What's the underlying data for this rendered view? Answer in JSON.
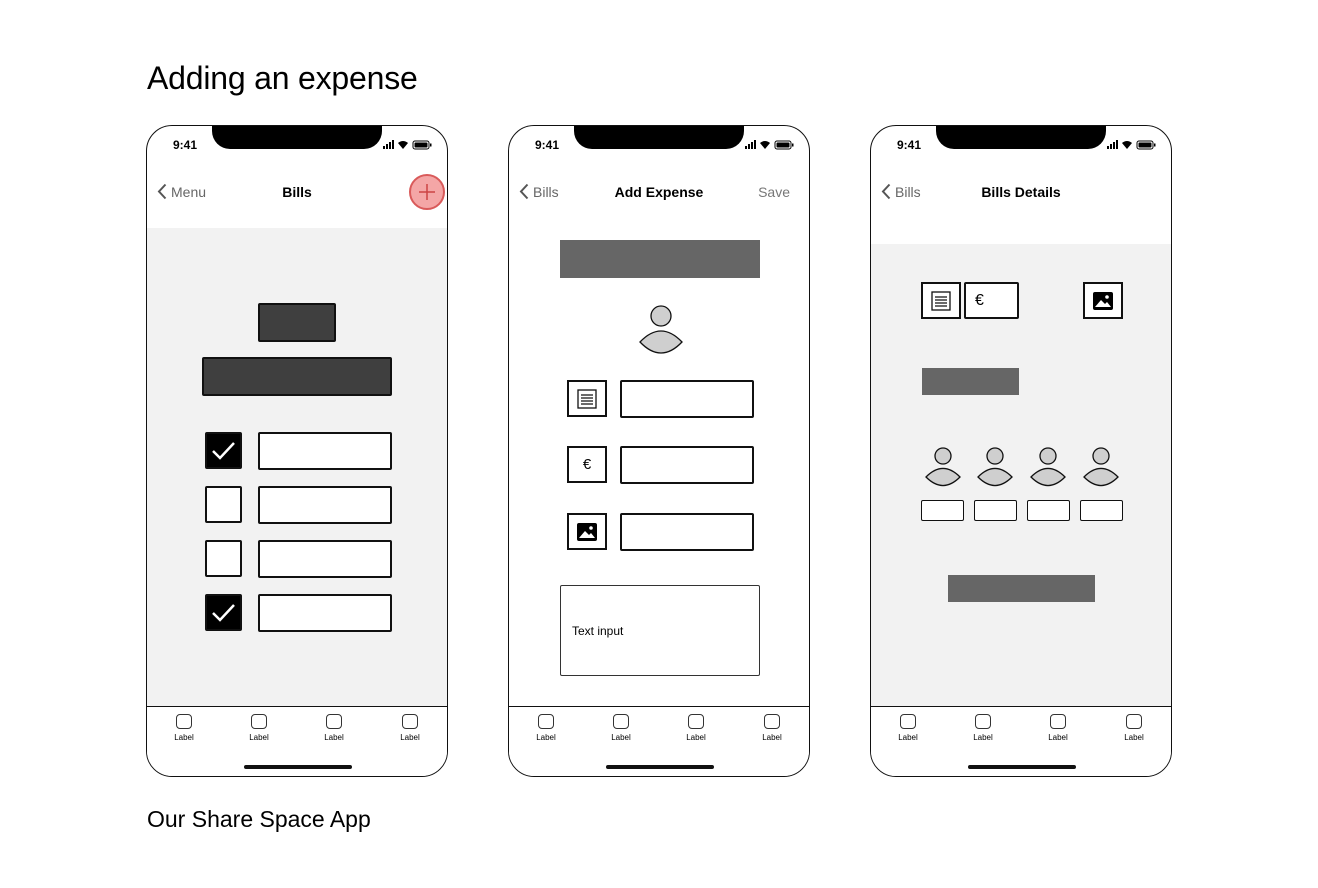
{
  "page": {
    "title": "Adding an expense",
    "footer": "Our Share Space App"
  },
  "status_time": "9:41",
  "tab_labels": [
    "Label",
    "Label",
    "Label",
    "Label"
  ],
  "screen1": {
    "back_label": "Menu",
    "title": "Bills",
    "add_icon": "plus-icon",
    "checklist": [
      true,
      false,
      false,
      true
    ]
  },
  "screen2": {
    "back_label": "Bills",
    "title": "Add Expense",
    "action_label": "Save",
    "euro_symbol": "€",
    "text_input": "Text input"
  },
  "screen3": {
    "back_label": "Bills",
    "title": "Bills Details",
    "euro_symbol": "€",
    "people_count": 4
  },
  "colors": {
    "accent_add": "#f4a6a6",
    "content_bg": "#f2f2f2",
    "placeholder_bar": "#666666"
  }
}
